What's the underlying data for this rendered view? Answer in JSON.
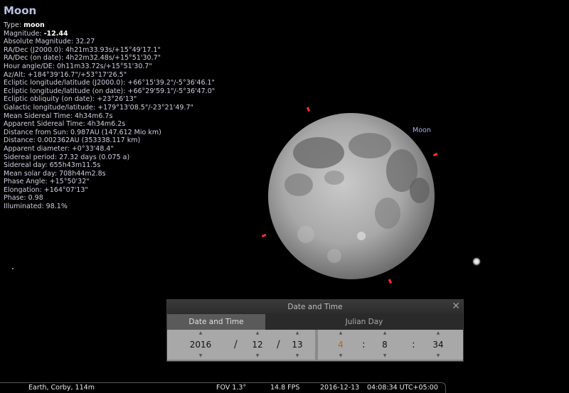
{
  "object": {
    "name": "Moon"
  },
  "info_rows": [
    {
      "label": "Type:",
      "value": "moon"
    },
    {
      "label": "Magnitude:",
      "value": "-12.44"
    },
    {
      "label": "Absolute Magnitude:",
      "value": "32.27"
    },
    {
      "label": "RA/Dec (J2000.0):",
      "value": "4h21m33.93s/+15°49'17.1\""
    },
    {
      "label": "RA/Dec (on date):",
      "value": "4h22m32.48s/+15°51'30.7\""
    },
    {
      "label": "Hour angle/DE:",
      "value": "0h11m33.72s/+15°51'30.7\""
    },
    {
      "label": "Az/Alt:",
      "value": "+184°39'16.7\"/+53°17'26.5\""
    },
    {
      "label": "Ecliptic longitude/latitude (J2000.0):",
      "value": "+66°15'39.2\"/-5°36'46.1\""
    },
    {
      "label": "Ecliptic longitude/latitude (on date):",
      "value": "+66°29'59.1\"/-5°36'47.0\""
    },
    {
      "label": "Ecliptic obliquity (on date):",
      "value": "+23°26'13\""
    },
    {
      "label": "Galactic longitude/latitude:",
      "value": "+179°13'08.5\"/-23°21'49.7\""
    },
    {
      "label": "Mean Sidereal Time:",
      "value": "4h34m6.7s"
    },
    {
      "label": "Apparent Sidereal Time:",
      "value": "4h34m6.2s"
    },
    {
      "label": "Distance from Sun:",
      "value": "0.987AU (147.612 Mio km)"
    },
    {
      "label": "Distance:",
      "value": "0.002362AU (353338.117 km)"
    },
    {
      "label": "Apparent diameter:",
      "value": "+0°33'48.4\""
    },
    {
      "label": "Sidereal period:",
      "value": "27.32 days (0.075 a)"
    },
    {
      "label": "Sidereal day:",
      "value": "655h43m11.5s"
    },
    {
      "label": "Mean solar day:",
      "value": "708h44m2.8s"
    },
    {
      "label": "Phase Angle:",
      "value": "+15°50'32\""
    },
    {
      "label": "Elongation:",
      "value": "+164°07'13\""
    },
    {
      "label": "Phase:",
      "value": "0.98"
    },
    {
      "label": "Illuminated:",
      "value": "98.1%"
    }
  ],
  "sky_label": "Moon",
  "date_time_dialog": {
    "title": "Date and Time",
    "close_glyph": "✕",
    "tabs": [
      "Date and Time",
      "Julian Day"
    ],
    "date": {
      "year": "2016",
      "month": "12",
      "day": "13",
      "separator": "/"
    },
    "time": {
      "hour": "4",
      "minute": "8",
      "second": "34",
      "separator": ":"
    }
  },
  "status_bar": {
    "location": "Earth, Corby, 114m",
    "fov": "FOV 1.3°",
    "fps": "14.8 FPS",
    "date": "2016-12-13",
    "time": "04:08:34 UTC+05:00"
  },
  "colors": {
    "background": "#000000",
    "moon_label": "#a8b4e8",
    "selection_marker": "#ff3030"
  }
}
